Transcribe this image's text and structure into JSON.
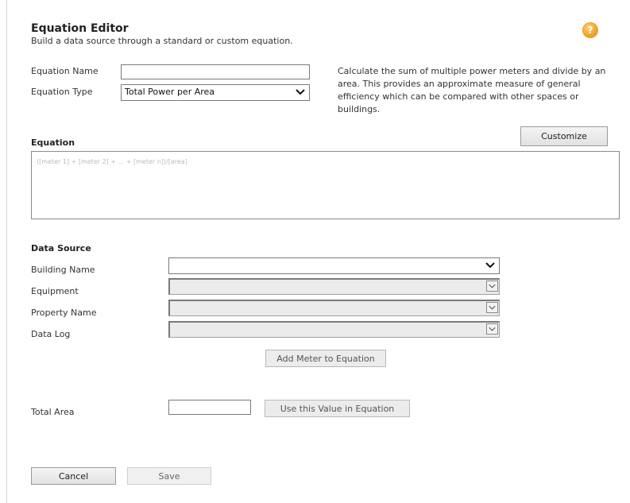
{
  "header": {
    "title": "Equation Editor",
    "subtitle": "Build a data source through a standard or custom equation.",
    "help_glyph": "?"
  },
  "form": {
    "equation_name_label": "Equation Name",
    "equation_name_value": "",
    "equation_type_label": "Equation Type",
    "equation_type_value": "Total Power per Area",
    "description": "Calculate the sum of multiple power meters and divide by an area. This provides an approximate measure of general efficiency which can be compared with other spaces or buildings."
  },
  "equation": {
    "section_label": "Equation",
    "customize_label": "Customize",
    "placeholder": "([meter 1] + [meter 2] + ... + [meter n])/[area]"
  },
  "data_source": {
    "section_label": "Data Source",
    "building_label": "Building Name",
    "building_value": "",
    "equipment_label": "Equipment",
    "property_label": "Property Name",
    "datalog_label": "Data Log",
    "add_meter_label": "Add Meter to Equation"
  },
  "area": {
    "label": "Total Area",
    "value": "",
    "use_value_label": "Use this Value in Equation"
  },
  "footer": {
    "cancel_label": "Cancel",
    "save_label": "Save"
  },
  "icons": {
    "help": "help-icon",
    "dropdown": "chevron-down-icon"
  },
  "colors": {
    "help_orange": "#f0a020",
    "button_bg": "#e8e8e8",
    "disabled_bg": "#ebebeb"
  }
}
